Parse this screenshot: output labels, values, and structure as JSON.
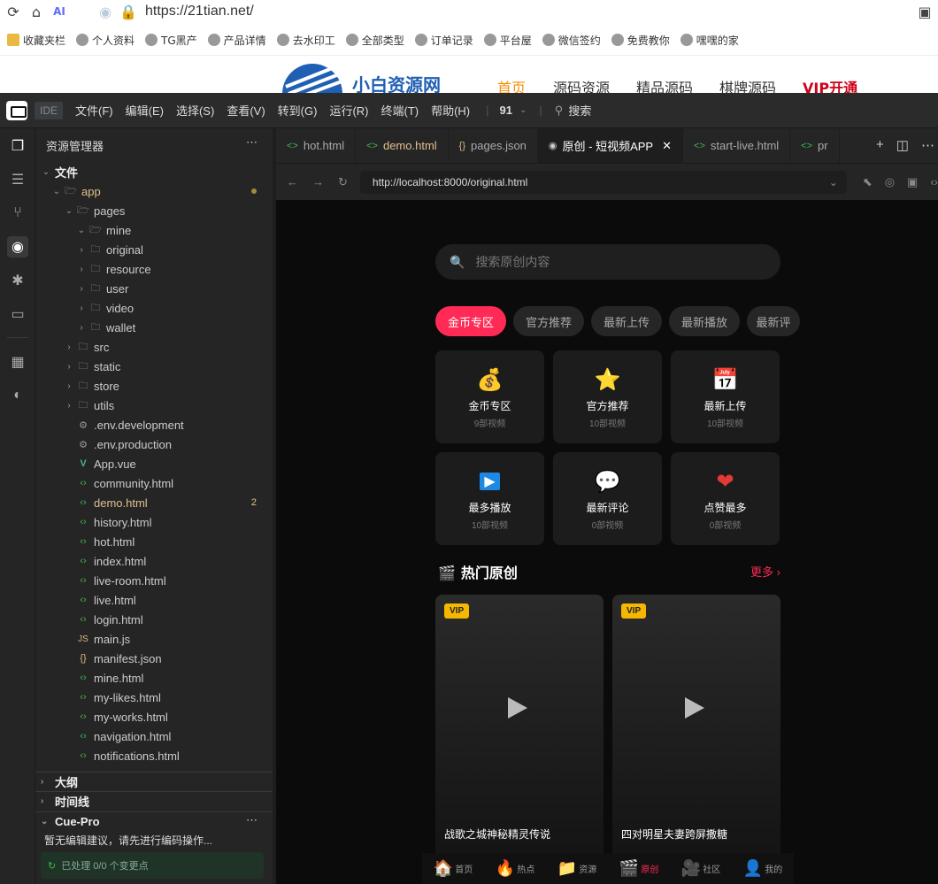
{
  "browser": {
    "url": "https://21tian.net/"
  },
  "bookmarks": [
    "收藏夹栏",
    "个人资料",
    "TG黑产",
    "产品详情",
    "去水印工",
    "全部类型",
    "订单记录",
    "平台屋",
    "微信签约",
    "免费教你",
    "嘿嘿的家"
  ],
  "site": {
    "name": "小白资源网",
    "nav": [
      "首页",
      "源码资源",
      "精品源码",
      "棋牌源码",
      "VIP开通"
    ],
    "active_color": "#f29100",
    "vip_color": "#d0021b"
  },
  "ide": {
    "badge": "IDE",
    "menus": [
      "文件(F)",
      "编辑(E)",
      "选择(S)",
      "查看(V)",
      "转到(G)",
      "运行(R)",
      "终端(T)",
      "帮助(H)"
    ],
    "version": "91",
    "search": "搜索",
    "explorer": {
      "title": "资源管理器",
      "section": "文件",
      "tree": [
        {
          "label": "app",
          "type": "folder",
          "open": true,
          "depth": 1,
          "color": "#e2c08d"
        },
        {
          "label": "pages",
          "type": "folder",
          "open": true,
          "depth": 2
        },
        {
          "label": "mine",
          "type": "folder",
          "open": true,
          "depth": 3
        },
        {
          "label": "original",
          "type": "folder",
          "depth": 3
        },
        {
          "label": "resource",
          "type": "folder",
          "depth": 3
        },
        {
          "label": "user",
          "type": "folder",
          "depth": 3
        },
        {
          "label": "video",
          "type": "folder",
          "depth": 3
        },
        {
          "label": "wallet",
          "type": "folder",
          "depth": 3
        },
        {
          "label": "src",
          "type": "folder",
          "depth": 2
        },
        {
          "label": "static",
          "type": "folder",
          "depth": 2
        },
        {
          "label": "store",
          "type": "folder",
          "depth": 2
        },
        {
          "label": "utils",
          "type": "folder",
          "depth": 2
        },
        {
          "label": ".env.development",
          "type": "gear",
          "depth": 2
        },
        {
          "label": ".env.production",
          "type": "gear",
          "depth": 2
        },
        {
          "label": "App.vue",
          "type": "vue",
          "depth": 2
        },
        {
          "label": "community.html",
          "type": "html",
          "depth": 2
        },
        {
          "label": "demo.html",
          "type": "html",
          "depth": 2,
          "color": "#e2c08d",
          "badge": "2"
        },
        {
          "label": "history.html",
          "type": "html",
          "depth": 2
        },
        {
          "label": "hot.html",
          "type": "html",
          "depth": 2
        },
        {
          "label": "index.html",
          "type": "html",
          "depth": 2
        },
        {
          "label": "live-room.html",
          "type": "html",
          "depth": 2
        },
        {
          "label": "live.html",
          "type": "html",
          "depth": 2
        },
        {
          "label": "login.html",
          "type": "html",
          "depth": 2
        },
        {
          "label": "main.js",
          "type": "js",
          "depth": 2
        },
        {
          "label": "manifest.json",
          "type": "json",
          "depth": 2
        },
        {
          "label": "mine.html",
          "type": "html",
          "depth": 2
        },
        {
          "label": "my-likes.html",
          "type": "html",
          "depth": 2
        },
        {
          "label": "my-works.html",
          "type": "html",
          "depth": 2
        },
        {
          "label": "navigation.html",
          "type": "html",
          "depth": 2
        },
        {
          "label": "notifications.html",
          "type": "html",
          "depth": 2
        }
      ],
      "panels": [
        "大纲",
        "时间线",
        "Cue-Pro"
      ],
      "cue_hint": "暂无编辑建议，请先进行编码操作...",
      "cue_status": "已处理 0/0 个变更点"
    },
    "tabs": [
      {
        "label": "hot.html",
        "icon": "<>"
      },
      {
        "label": "demo.html",
        "icon": "<>",
        "color": "#e2c08d"
      },
      {
        "label": "pages.json",
        "icon": "{}"
      },
      {
        "label": "原创 - 短视频APP",
        "icon": "eye",
        "active": true
      },
      {
        "label": "start-live.html",
        "icon": "<>"
      },
      {
        "label": "pr",
        "icon": "<>"
      }
    ],
    "preview_url": "http://localhost:8000/original.html"
  },
  "app": {
    "search_placeholder": "搜索原创内容",
    "chips": [
      "金币专区",
      "官方推荐",
      "最新上传",
      "最新播放",
      "最新评"
    ],
    "categories": [
      {
        "name": "金币专区",
        "count": "9部视频",
        "icon": "💰"
      },
      {
        "name": "官方推荐",
        "count": "10部视频",
        "icon": "⭐"
      },
      {
        "name": "最新上传",
        "count": "10部视频",
        "icon": "📅"
      },
      {
        "name": "最多播放",
        "count": "10部视频",
        "icon": "▶"
      },
      {
        "name": "最新评论",
        "count": "0部视频",
        "icon": "💬"
      },
      {
        "name": "点赞最多",
        "count": "0部视频",
        "icon": "❤"
      }
    ],
    "hot_title": "热门原创",
    "more": "更多 ›",
    "videos": [
      {
        "title": "战歌之城神秘精灵传说",
        "badge": "VIP"
      },
      {
        "title": "四对明星夫妻跨屏撒糖",
        "badge": "VIP"
      }
    ],
    "tabbar": [
      {
        "label": "首页",
        "icon": "🏠"
      },
      {
        "label": "热点",
        "icon": "🔥"
      },
      {
        "label": "资源",
        "icon": "📁"
      },
      {
        "label": "原创",
        "icon": "🎬",
        "active": true
      },
      {
        "label": "社区",
        "icon": "🎥"
      },
      {
        "label": "我的",
        "icon": "👤"
      }
    ],
    "accent": "#ff2a55"
  }
}
